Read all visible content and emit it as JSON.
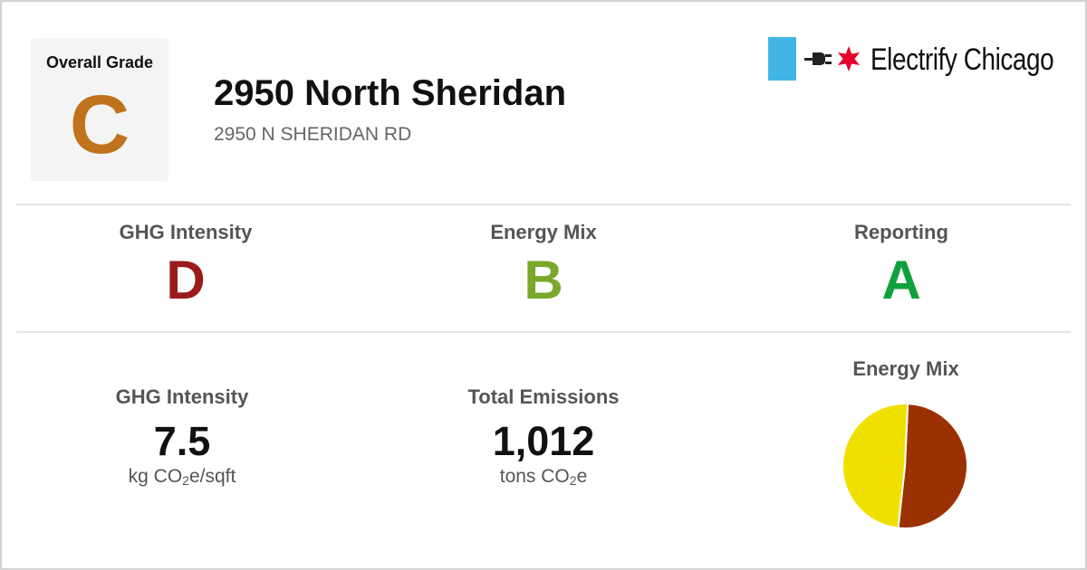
{
  "overall": {
    "label": "Overall Grade",
    "grade": "C",
    "grade_color": "#c0731c"
  },
  "building": {
    "name": "2950 North Sheridan",
    "address": "2950 N SHERIDAN RD"
  },
  "brand": {
    "name": "Electrify Chicago",
    "accent_blue": "#41b6e6",
    "star_red": "#e4002b",
    "icons": [
      "plug-icon",
      "chicago-star-icon"
    ]
  },
  "grades": [
    {
      "label": "GHG Intensity",
      "grade": "D",
      "color": "#9b1b1b"
    },
    {
      "label": "Energy Mix",
      "grade": "B",
      "color": "#7aa82a"
    },
    {
      "label": "Reporting",
      "grade": "A",
      "color": "#10a03e"
    }
  ],
  "stats": {
    "ghg": {
      "label": "GHG Intensity",
      "value": "7.5",
      "unit_prefix": "kg CO",
      "unit_sub": "2",
      "unit_suffix": "e/sqft"
    },
    "emissions": {
      "label": "Total Emissions",
      "value": "1,012",
      "unit_prefix": "tons CO",
      "unit_sub": "2",
      "unit_suffix": "e"
    }
  },
  "energy_mix": {
    "label": "Energy Mix",
    "slices": [
      {
        "value": 51,
        "color": "#9b3100"
      },
      {
        "value": 49,
        "color": "#f0e000"
      }
    ]
  }
}
